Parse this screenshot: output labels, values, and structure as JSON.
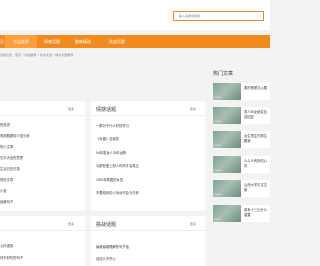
{
  "search": {
    "placeholder": "输入关键词搜索..."
  },
  "nav": {
    "items": [
      {
        "label": "首页"
      },
      {
        "label": "作品推荐"
      },
      {
        "label": "情感话题"
      },
      {
        "label": "趣味精选"
      },
      {
        "label": "挑战话题"
      }
    ]
  },
  "breadcrumb": "当前位置：首页 > 作品推荐 > 技术文章 > 精彩文章推荐",
  "left_panel": {
    "more": "更多",
    "items": [
      "的说说",
      "电视剧剧情介绍分析",
      "的小文章",
      "汉字大全的意思",
      "生活日志记录",
      "的好文章",
      "小说",
      "经典句子"
    ]
  },
  "emotion_panel": {
    "title": "情感话题",
    "more": "更多",
    "items": [
      "一群对于什么好好学习",
      "《青春》全部历",
      "94年属龙人今年运势",
      "与那些爱上别人时你才会真正",
      "1992年属猴的女性",
      "不要给你的人永远不会亏欠你"
    ]
  },
  "bottom_left": {
    "more": "更多",
    "items": [
      "心情语录",
      "好不好吃的句子"
    ]
  },
  "challenge_panel": {
    "title": "挑战话题",
    "more": "更多",
    "items": [
      "最难最难理解的句子话",
      "该怎么不开心"
    ]
  },
  "hot": {
    "title": "热门文章",
    "items": [
      {
        "text": "柔的爸爸又心酸",
        "thumb": "THUMB"
      },
      {
        "text": "男人叫女朋友应该回复",
        "thumb": "THUMB"
      },
      {
        "text": "女生很生怕男生跟我",
        "thumb": "THUMB"
      },
      {
        "text": "么么么有好的心情",
        "thumb": "THUMB"
      },
      {
        "text": "山西大学中文文案",
        "thumb": "THUMB"
      },
      {
        "text": "原来十三比什么重要",
        "thumb": "THUMB"
      }
    ]
  }
}
